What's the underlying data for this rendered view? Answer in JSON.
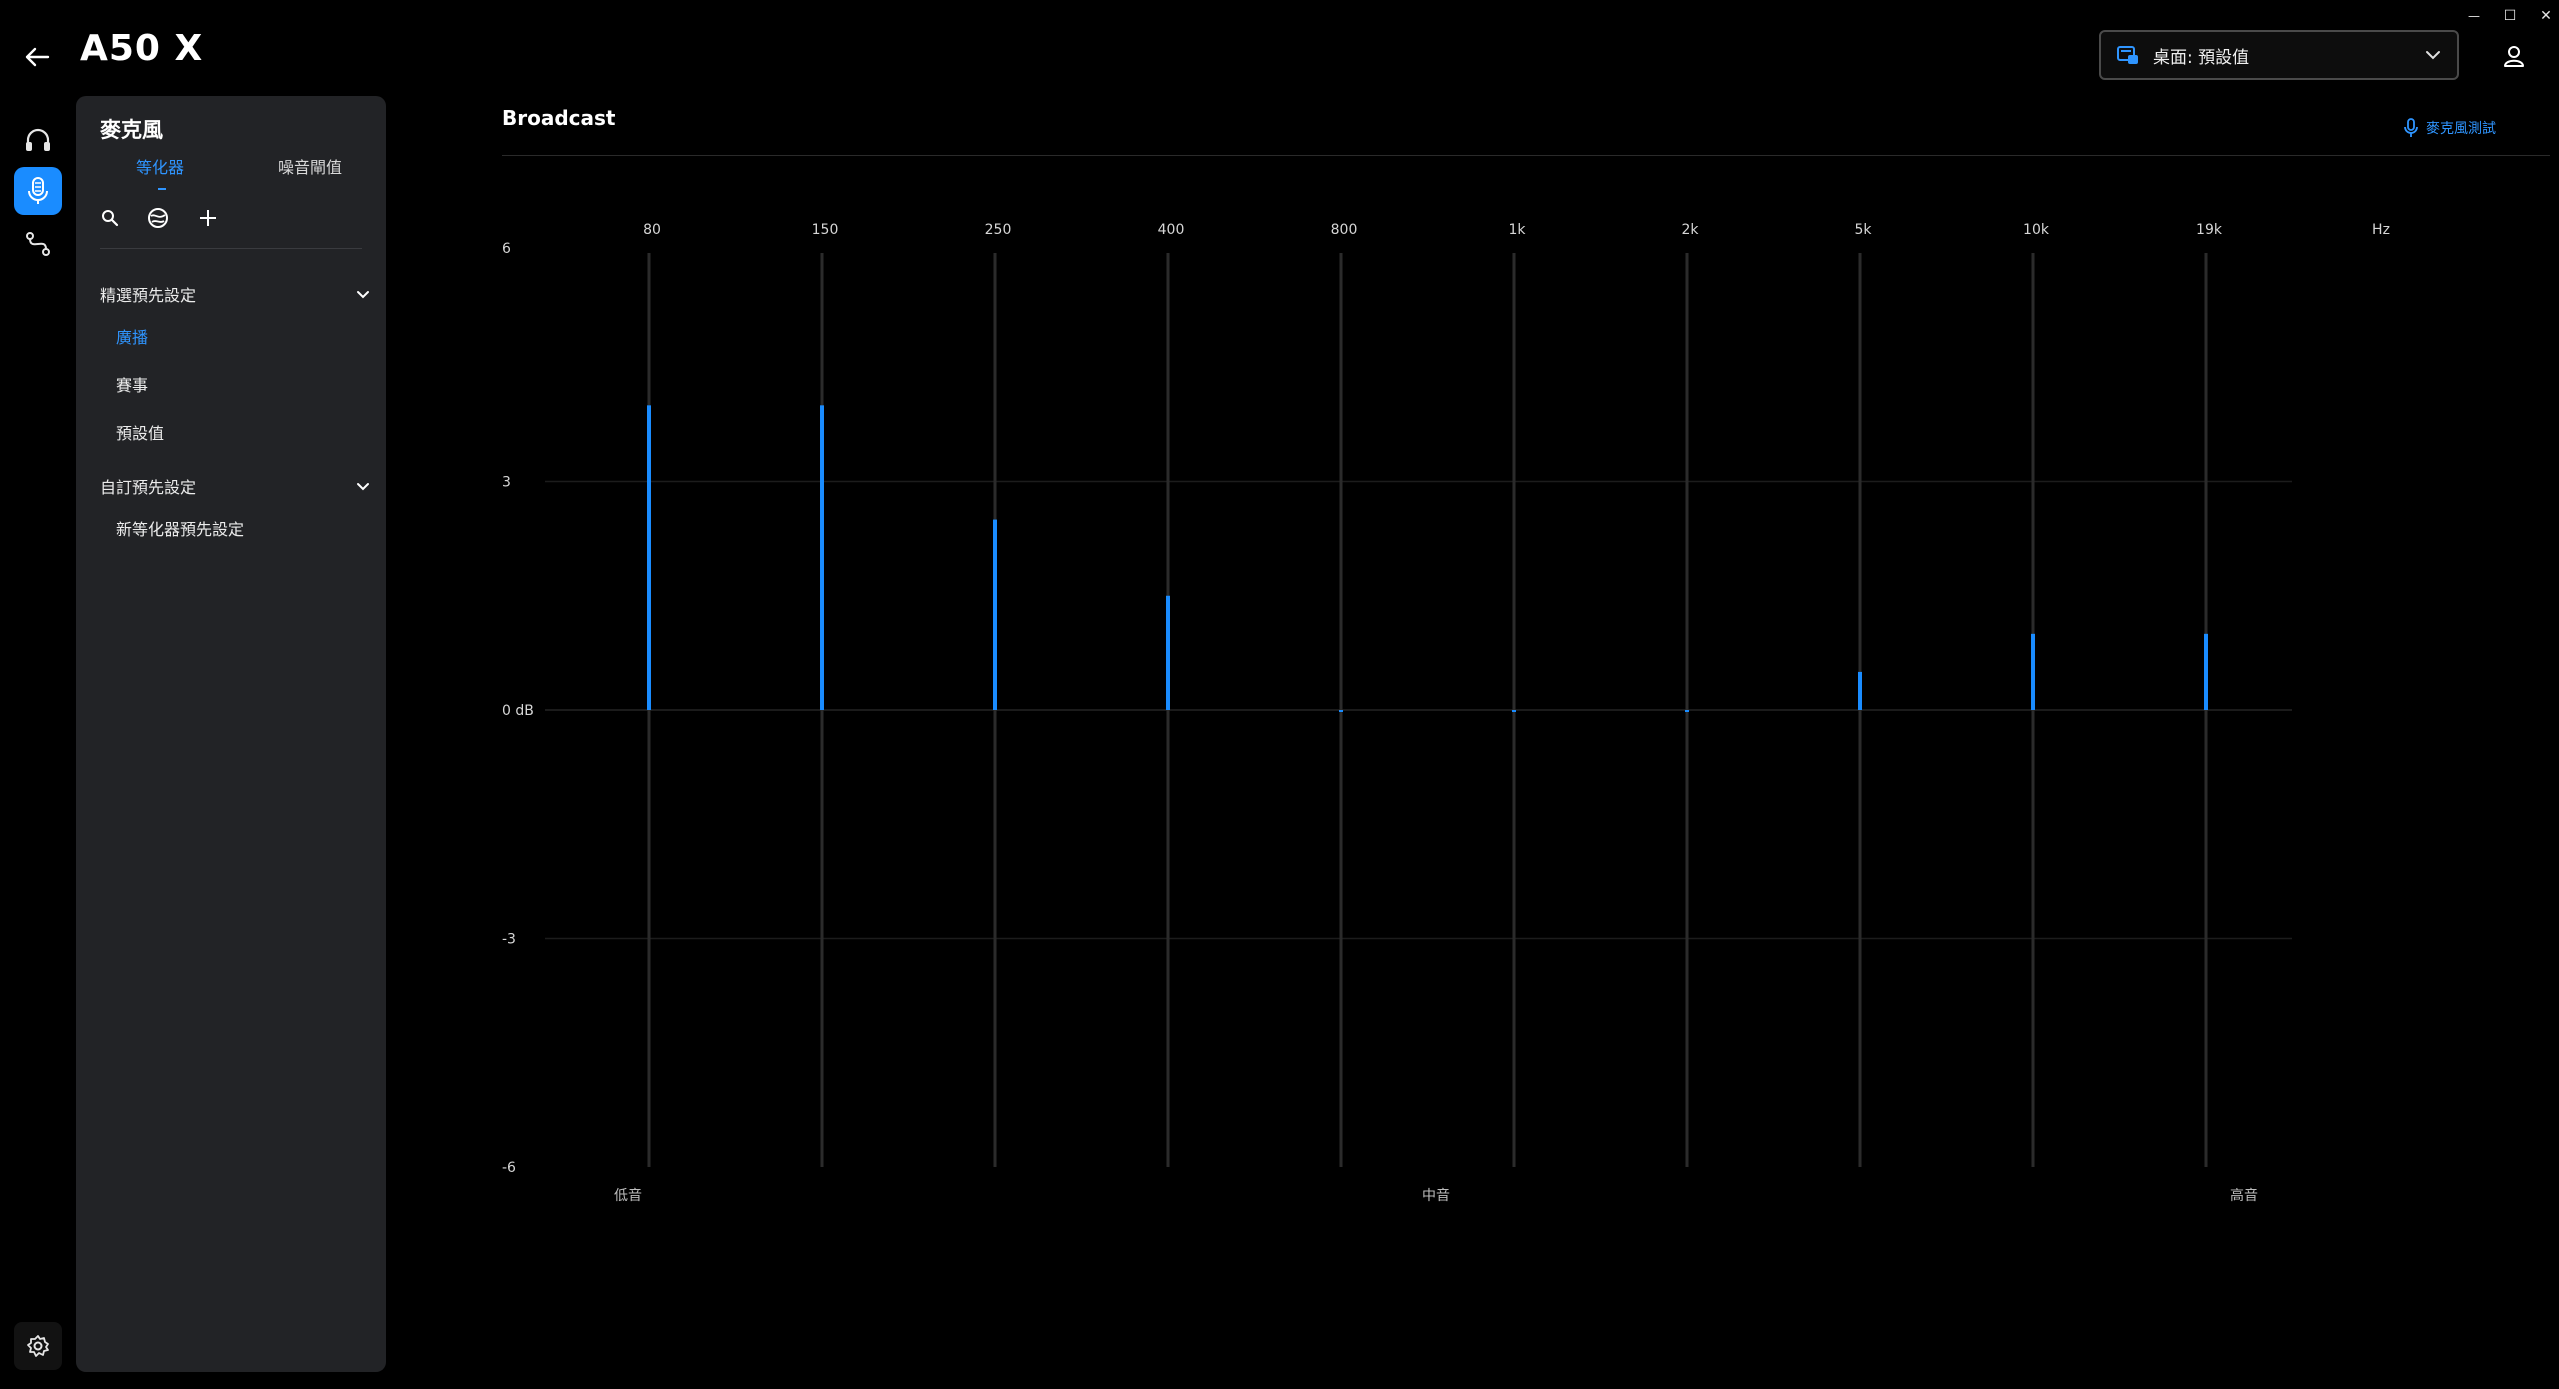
{
  "window": {
    "minimize": "—",
    "maximize": "☐",
    "close": "✕"
  },
  "header": {
    "title": "A50 X",
    "preset_dropdown": "桌面: 預設值"
  },
  "rail": {
    "items": [
      {
        "icon": "headphones-icon",
        "active": false
      },
      {
        "icon": "microphone-icon",
        "active": true
      },
      {
        "icon": "routing-icon",
        "active": false
      }
    ],
    "settings_icon": "gear-icon"
  },
  "panel": {
    "title": "麥克風",
    "tabs": [
      {
        "label": "等化器",
        "active": true
      },
      {
        "label": "噪音閘值",
        "active": false
      }
    ],
    "sections": [
      {
        "title": "精選預先設定",
        "items": [
          {
            "label": "廣播",
            "active": true
          },
          {
            "label": "賽事",
            "active": false
          },
          {
            "label": "預設值",
            "active": false
          }
        ]
      },
      {
        "title": "自訂預先設定",
        "items": [
          {
            "label": "新等化器預先設定",
            "active": false
          }
        ]
      }
    ]
  },
  "eq": {
    "title": "Broadcast",
    "mic_test": "麥克風測試",
    "bottom_labels": [
      "低音",
      "中音",
      "高音"
    ]
  },
  "colors": {
    "accent": "#1a8cff",
    "background": "#000000",
    "panel": "#222326",
    "slider_track": "#2b2b2b",
    "gridline": "#1c1c1c"
  },
  "chart_data": {
    "type": "bar",
    "categories": [
      "80",
      "150",
      "250",
      "400",
      "800",
      "1k",
      "2k",
      "5k",
      "10k",
      "19k"
    ],
    "unit_label": "Hz",
    "values": [
      4.0,
      4.0,
      2.5,
      1.5,
      0.0,
      0.0,
      0.0,
      0.5,
      1.0,
      1.0
    ],
    "y_ticks": [
      "6",
      "3",
      "0 dB",
      "-3",
      "-6"
    ],
    "ylim": [
      -6,
      6
    ],
    "grid": true
  }
}
